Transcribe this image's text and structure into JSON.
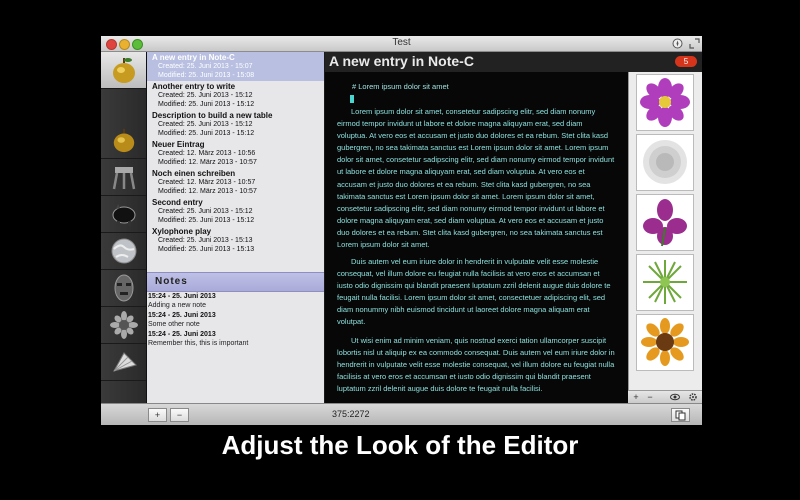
{
  "window": {
    "title": "Test"
  },
  "entries": [
    {
      "title": "A new entry in Note-C",
      "created": "Created: 25. Juni 2013 - 15:07",
      "modified": "Modified: 25. Juni 2013 - 15:08",
      "selected": true
    },
    {
      "title": "Another entry to write",
      "created": "Created: 25. Juni 2013 - 15:12",
      "modified": "Modified: 25. Juni 2013 - 15:12"
    },
    {
      "title": "Description to build a new table",
      "created": "Created: 25. Juni 2013 - 15:12",
      "modified": "Modified: 25. Juni 2013 - 15:12"
    },
    {
      "title": "Neuer Eintrag",
      "created": "Created: 12. März 2013 - 10:56",
      "modified": "Modified: 12. März 2013 - 10:57"
    },
    {
      "title": "Noch einen schreiben",
      "created": "Created: 12. März 2013 - 10:57",
      "modified": "Modified: 12. März 2013 - 10:57"
    },
    {
      "title": "Second entry",
      "created": "Created: 25. Juni 2013 - 15:12",
      "modified": "Modified: 25. Juni 2013 - 15:12"
    },
    {
      "title": "Xylophone play",
      "created": "Created: 25. Juni 2013 - 15:13",
      "modified": "Modified: 25. Juni 2013 - 15:13"
    }
  ],
  "notes": {
    "header": "Notes",
    "items": [
      {
        "date": "15:24 - 25. Juni 2013",
        "text": "Adding a new note"
      },
      {
        "date": "15:24 - 25. Juni 2013",
        "text": "Some other note"
      },
      {
        "date": "15:24 - 25. Juni 2013",
        "text": "Remember this, this is important"
      }
    ]
  },
  "editor": {
    "title": "A new entry in Note-C",
    "badge": "5",
    "heading": "# Lorem ipsum dolor sit amet",
    "paragraphs": [
      "Lorem ipsum dolor sit amet, consetetur sadipscing elitr, sed diam nonumy eirmod tempor invidunt ut labore et dolore magna aliquyam erat, sed diam voluptua. At vero eos et accusam et justo duo dolores et ea rebum. Stet clita kasd gubergren, no sea takimata sanctus est Lorem ipsum dolor sit amet. Lorem ipsum dolor sit amet, consetetur sadipscing elitr, sed diam nonumy eirmod tempor invidunt ut labore et dolore magna aliquyam erat, sed diam voluptua. At vero eos et accusam et justo duo dolores et ea rebum. Stet clita kasd gubergren, no sea takimata sanctus est Lorem ipsum dolor sit amet. Lorem ipsum dolor sit amet, consetetur sadipscing elitr, sed diam nonumy eirmod tempor invidunt ut labore et dolore magna aliquyam erat, sed diam voluptua. At vero eos et accusam et justo duo dolores et ea rebum. Stet clita kasd gubergren, no sea takimata sanctus est Lorem ipsum dolor sit amet.",
      "Duis autem vel eum iriure dolor in hendrerit in vulputate velit esse molestie consequat, vel illum dolore eu feugiat nulla facilisis at vero eros et accumsan et iusto odio dignissim qui blandit praesent luptatum zzril delenit augue duis dolore te feugait nulla facilisi. Lorem ipsum dolor sit amet, consectetuer adipiscing elit, sed diam nonummy nibh euismod tincidunt ut laoreet dolore magna aliquam erat volutpat.",
      "Ut wisi enim ad minim veniam, quis nostrud exerci tation ullamcorper suscipit lobortis nisl ut aliquip ex ea commodo consequat. Duis autem vel eum iriure dolor in hendrerit in vulputate velit esse molestie consequat, vel illum dolore eu feugiat nulla facilisis at vero eros et accumsan et iusto odio dignissim qui blandit praesent luptatum zzril delenit augue duis dolore te feugait nulla facilisi."
    ]
  },
  "status": {
    "position": "375:2272",
    "add": "+",
    "remove": "−"
  },
  "image_tools": {
    "add": "+",
    "remove": "−"
  },
  "sidebar_icons": [
    "apple-icon",
    "apple-icon",
    "stool-icon",
    "piggy-bank-icon",
    "globe-icon",
    "tribal-mask-icon",
    "sunflower-icon",
    "fan-icon"
  ],
  "thumbnails": [
    {
      "name": "purple-flower-icon",
      "color": "#b03dbb"
    },
    {
      "name": "white-flower-icon",
      "color": "#dcdcdc"
    },
    {
      "name": "magenta-flower-icon",
      "color": "#9b2d8e"
    },
    {
      "name": "green-flower-icon",
      "color": "#6fa83a"
    },
    {
      "name": "sunflower-icon",
      "color": "#e59a1f"
    }
  ],
  "caption": "Adjust the Look of the Editor"
}
